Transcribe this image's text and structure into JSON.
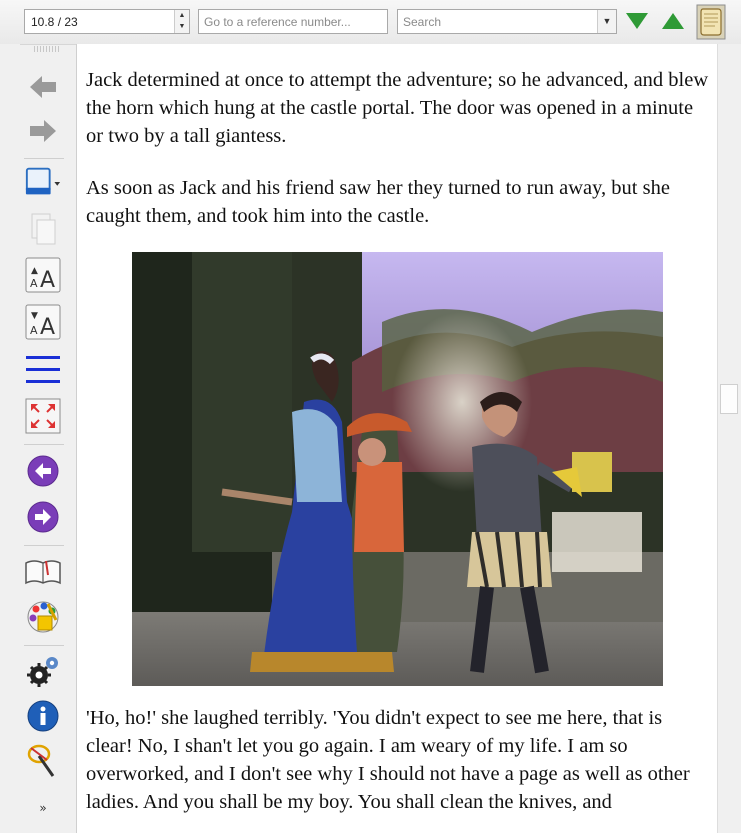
{
  "toolbar": {
    "location_value": "10.8 / 23",
    "reference_placeholder": "Go to a reference number...",
    "search_placeholder": "Search"
  },
  "sidebar": {
    "icons": [
      "back-arrow-icon",
      "forward-arrow-icon",
      "screen-icon",
      "copy-icon",
      "increase-font-icon",
      "decrease-font-icon",
      "lines-icon",
      "fullscreen-icon",
      "previous-icon",
      "next-icon",
      "book-icon",
      "palette-icon",
      "settings-icon",
      "info-icon",
      "magic-wand-icon",
      "more-icon"
    ]
  },
  "content": {
    "paragraph1": "Jack determined at once to attempt the adventure; so he advanced, and blew the horn which hung at the castle portal. The door was opened in a minute or two by a tall giantess.",
    "paragraph2": "As soon as Jack and his friend saw her they turned to run away, but she caught them, and took him into the castle.",
    "paragraph3": "'Ho, ho!' she laughed terribly. 'You didn't expect to see me here, that is clear! No, I shan't let you go again. I am weary of my life. I am so overworked, and I don't see why I should not have a page as well as other ladies. And you shall be my boy. You shall clean the knives, and"
  },
  "colors": {
    "nav_green": "#2f9a36",
    "purple": "#7a3db8",
    "info_blue": "#1f5fb8",
    "lines_blue": "#1a2fd6"
  }
}
